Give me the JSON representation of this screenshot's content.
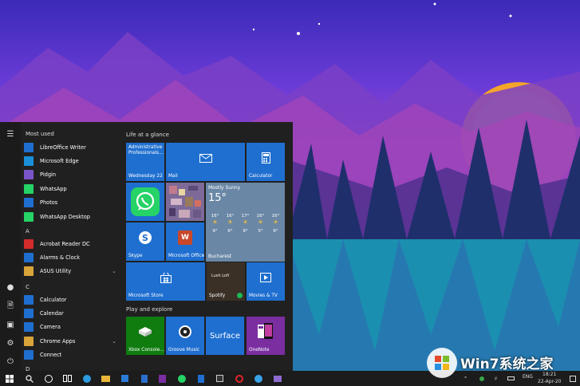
{
  "start_menu": {
    "most_used_header": "Most used",
    "most_used": [
      {
        "label": "LibreOffice Writer",
        "icon": "libreoffice-writer-icon",
        "color": "#1f6fd0"
      },
      {
        "label": "Microsoft Edge",
        "icon": "edge-icon",
        "color": "#1a8fd8"
      },
      {
        "label": "Pidgin",
        "icon": "pidgin-icon",
        "color": "#7a55c8"
      },
      {
        "label": "WhatsApp",
        "icon": "whatsapp-icon",
        "color": "#25d366"
      },
      {
        "label": "Photos",
        "icon": "photos-icon",
        "color": "#1f6fd0"
      },
      {
        "label": "WhatsApp Desktop",
        "icon": "whatsapp-icon",
        "color": "#25d366"
      }
    ],
    "letter_a": "A",
    "group_a": [
      {
        "label": "Acrobat Reader DC",
        "icon": "acrobat-icon",
        "color": "#d42b2b"
      },
      {
        "label": "Alarms & Clock",
        "icon": "alarm-clock-icon",
        "color": "#1f6fd0"
      },
      {
        "label": "ASUS Utility",
        "icon": "folder-icon",
        "color": "#d9a43a",
        "expand": true
      }
    ],
    "letter_c": "C",
    "group_c": [
      {
        "label": "Calculator",
        "icon": "calculator-icon",
        "color": "#1f6fd0"
      },
      {
        "label": "Calendar",
        "icon": "calendar-icon",
        "color": "#1f6fd0"
      },
      {
        "label": "Camera",
        "icon": "camera-icon",
        "color": "#1f6fd0"
      },
      {
        "label": "Chrome Apps",
        "icon": "folder-icon",
        "color": "#d9a43a",
        "expand": true
      },
      {
        "label": "Connect",
        "icon": "connect-icon",
        "color": "#1f6fd0"
      }
    ],
    "letter_d": "D",
    "life_header": "Life at a glance",
    "play_header": "Play and explore",
    "tiles": {
      "calendar_event": "Administrative Professionals...",
      "calendar_day": "Wednesday 22",
      "mail": "Mail",
      "calculator": "Calculator",
      "skype": "Skype",
      "office": "Microsoft Office",
      "weather_cond": "Mostly Sunny",
      "weather_temp": "15°",
      "weather_city": "Bucharest",
      "forecast": [
        {
          "hi": "16°",
          "lo": "9°"
        },
        {
          "hi": "16°",
          "lo": "6°"
        },
        {
          "hi": "17°",
          "lo": "9°"
        },
        {
          "hi": "16°",
          "lo": "5°"
        },
        {
          "hi": "16°",
          "lo": "6°"
        }
      ],
      "store": "Microsoft Store",
      "spotify": "Spotify",
      "spotify_text": "Lush Lofi",
      "movies": "Movies & TV",
      "xbox": "Xbox Console...",
      "groove": "Groove Music",
      "surface": "Surface",
      "onenote": "OneNote"
    }
  },
  "taskbar": {
    "lang": "ENG",
    "time": "18:21",
    "date": "22-Apr-20"
  },
  "watermark": {
    "brand": "Win7系统之家"
  }
}
